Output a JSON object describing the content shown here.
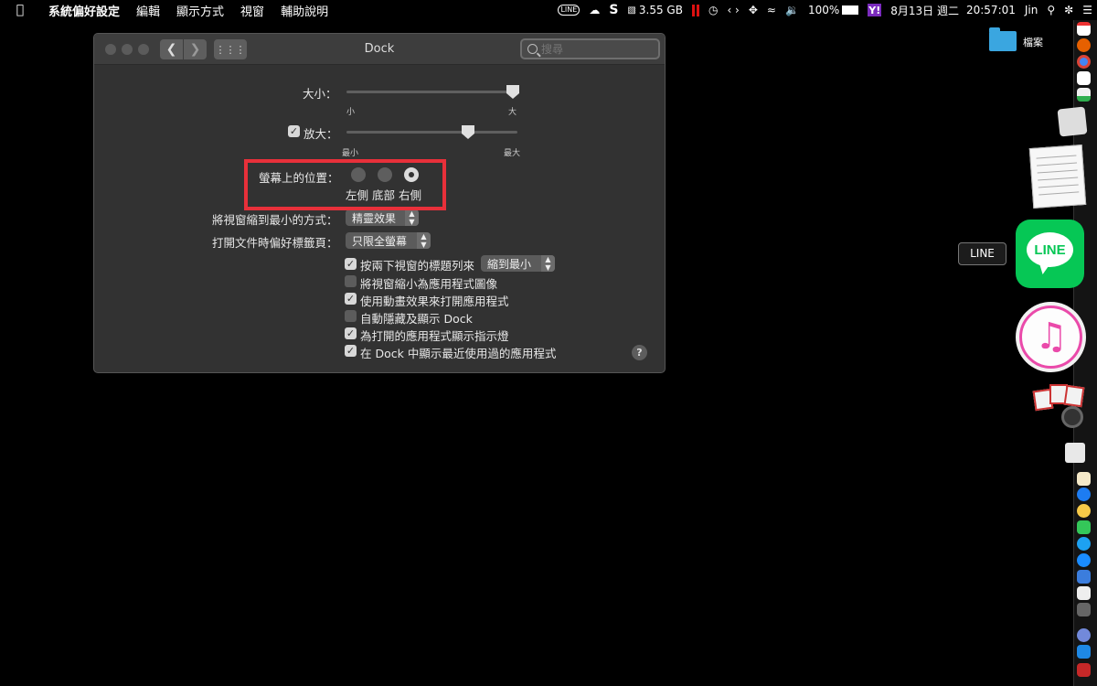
{
  "menubar": {
    "apple_icon": "apple-logo-icon",
    "app_name": "系統偏好設定",
    "menus": [
      "編輯",
      "顯示方式",
      "視窗",
      "輔助說明"
    ],
    "status": {
      "line_badge": "LINE",
      "storage": "3.55 GB",
      "battery": "100%",
      "yahoo": "Y!",
      "date": "8月13日 週二",
      "time": "20:57:01",
      "user": "Jin"
    }
  },
  "window": {
    "title": "Dock",
    "search_placeholder": "搜尋",
    "size": {
      "label": "大小：",
      "min_label": "小",
      "max_label": "大",
      "value_fraction": 1.0
    },
    "magnification": {
      "label": "放大：",
      "checked": true,
      "min_label": "最小",
      "max_label": "最大",
      "value_fraction": 0.7
    },
    "position": {
      "label": "螢幕上的位置：",
      "options": [
        "左側",
        "底部",
        "右側"
      ],
      "selected": "右側"
    },
    "minimize_effect": {
      "label": "將視窗縮到最小的方式：",
      "value": "精靈效果"
    },
    "prefer_tabs": {
      "label": "打開文件時偏好標籤頁：",
      "value": "只限全螢幕"
    },
    "double_click": {
      "label": "按兩下視窗的標題列來",
      "checked": true,
      "value": "縮到最小"
    },
    "checkboxes": [
      {
        "label": "將視窗縮小為應用程式圖像",
        "checked": false
      },
      {
        "label": "使用動畫效果來打開應用程式",
        "checked": true
      },
      {
        "label": "自動隱藏及顯示 Dock",
        "checked": false
      },
      {
        "label": "為打開的應用程式顯示指示燈",
        "checked": true
      },
      {
        "label": "在 Dock 中顯示最近使用過的應用程式",
        "checked": true
      }
    ],
    "help_label": "?"
  },
  "desktop": {
    "folder_label": "檔案",
    "line_tooltip": "LINE",
    "line_app_text": "LINE"
  },
  "colors": {
    "highlight": "#e8303a",
    "line_green": "#06c755",
    "itunes_pink": "#ea4aaa"
  }
}
